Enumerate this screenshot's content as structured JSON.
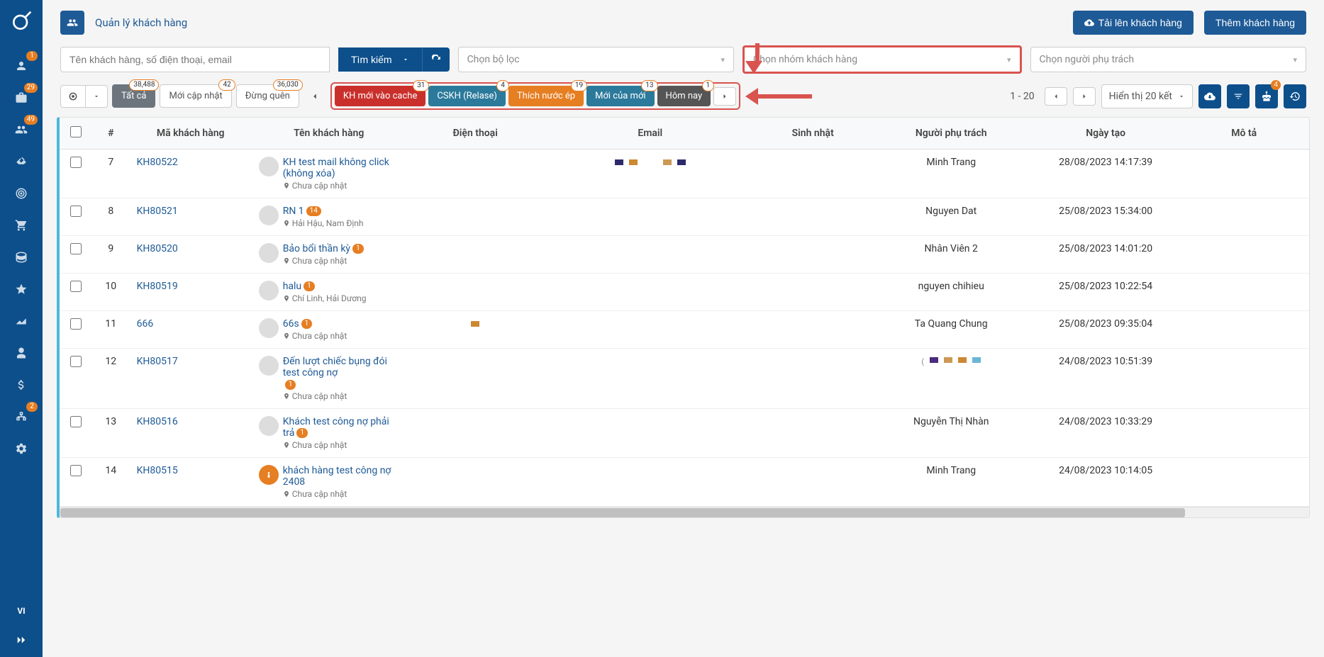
{
  "sidebar": {
    "lang": "VI",
    "items": [
      {
        "icon": "user",
        "badge": "1"
      },
      {
        "icon": "briefcase",
        "badge": "29"
      },
      {
        "icon": "users",
        "badge": "49"
      },
      {
        "icon": "handshake",
        "badge": null
      },
      {
        "icon": "target",
        "badge": null
      },
      {
        "icon": "cart",
        "badge": null
      },
      {
        "icon": "coins",
        "badge": null
      },
      {
        "icon": "star",
        "badge": null
      },
      {
        "icon": "chart",
        "badge": null
      },
      {
        "icon": "person",
        "badge": null
      },
      {
        "icon": "dollar",
        "badge": null
      },
      {
        "icon": "sitemap",
        "badge": "2"
      },
      {
        "icon": "gear",
        "badge": null
      }
    ]
  },
  "header": {
    "title": "Quản lý khách hàng",
    "upload_btn": "Tải lên khách hàng",
    "add_btn": "Thêm khách hàng"
  },
  "filters": {
    "search_placeholder": "Tên khách hàng, số điện thoại, email",
    "search_btn": "Tìm kiếm",
    "filter_placeholder": "Chọn bộ lọc",
    "group_placeholder": "Chọn nhóm khách hàng",
    "assignee_placeholder": "Chọn người phụ trách"
  },
  "pills": {
    "all": {
      "label": "Tất cả",
      "badge": "38,488"
    },
    "new_update": {
      "label": "Mới cập nhật",
      "badge": "42"
    },
    "forget": {
      "label": "Đừng quên",
      "badge": "36,030"
    }
  },
  "tags": [
    {
      "label": "KH mới vào cache",
      "badge": "31",
      "cls": "tag-red"
    },
    {
      "label": "CSKH (Relase)",
      "badge": "4",
      "cls": "tag-teal"
    },
    {
      "label": "Thích nước ép",
      "badge": "19",
      "cls": "tag-orange"
    },
    {
      "label": "Mới của mới",
      "badge": "13",
      "cls": "tag-teal"
    },
    {
      "label": "Hôm nay",
      "badge": "1",
      "cls": "tag-dark"
    }
  ],
  "pagination": {
    "range": "1 - 20",
    "display": "Hiển thị 20 kết",
    "birthday_badge": "4"
  },
  "table": {
    "headers": {
      "num": "#",
      "code": "Mã khách hàng",
      "name": "Tên khách hàng",
      "phone": "Điện thoại",
      "email": "Email",
      "birthday": "Sinh nhật",
      "assignee": "Người phụ trách",
      "created": "Ngày tạo",
      "desc": "Mô tả"
    },
    "rows": [
      {
        "num": "7",
        "code": "KH80522",
        "name": "KH test mail không click (không xóa)",
        "loc": "Chưa cập nhật",
        "badge": null,
        "assignee": "Minh Trang",
        "created": "28/08/2023 14:17:39",
        "email_bars": true,
        "avatar_special": false,
        "bars2": false
      },
      {
        "num": "8",
        "code": "KH80521",
        "name": "RN 1",
        "loc": "Hải Hậu, Nam Định",
        "badge": "14",
        "assignee": "Nguyen Dat",
        "created": "25/08/2023 15:34:00",
        "email_bars": false,
        "avatar_special": false,
        "bars2": false
      },
      {
        "num": "9",
        "code": "KH80520",
        "name": "Bảo bổi thần kỳ",
        "loc": "Chưa cập nhật",
        "badge": "1",
        "assignee": "Nhân Viên 2",
        "created": "25/08/2023 14:01:20",
        "email_bars": false,
        "avatar_special": false,
        "bars2": false
      },
      {
        "num": "10",
        "code": "KH80519",
        "name": "halu",
        "loc": "Chí Linh, Hải Dương",
        "badge": "1",
        "assignee": "nguyen chihieu",
        "created": "25/08/2023 10:22:54",
        "email_bars": false,
        "avatar_special": false,
        "bars2": false
      },
      {
        "num": "11",
        "code": "666",
        "name": "66s",
        "loc": "Chưa cập nhật",
        "badge": "1",
        "assignee": "Ta Quang Chung",
        "created": "25/08/2023 09:35:04",
        "email_bars": false,
        "phone_bar": true,
        "avatar_special": false,
        "bars2": false
      },
      {
        "num": "12",
        "code": "KH80517",
        "name": "Đến lượt chiếc bụng đói test công nợ",
        "loc": "Chưa cập nhật",
        "badge": "1",
        "assignee": "",
        "created": "24/08/2023 10:51:39",
        "email_bars": false,
        "avatar_special": false,
        "bars2": true,
        "badge_below": true
      },
      {
        "num": "13",
        "code": "KH80516",
        "name": "Khách test công nợ phải trả",
        "loc": "Chưa cập nhật",
        "badge": "1",
        "assignee": "Nguyễn Thị Nhàn",
        "created": "24/08/2023 10:33:29",
        "email_bars": false,
        "avatar_special": false,
        "bars2": false
      },
      {
        "num": "14",
        "code": "KH80515",
        "name": "khách hàng test công nợ 2408",
        "loc": "Chưa cập nhật",
        "badge": null,
        "assignee": "Minh Trang",
        "created": "24/08/2023 10:14:05",
        "email_bars": false,
        "avatar_special": true,
        "bars2": false
      }
    ]
  }
}
